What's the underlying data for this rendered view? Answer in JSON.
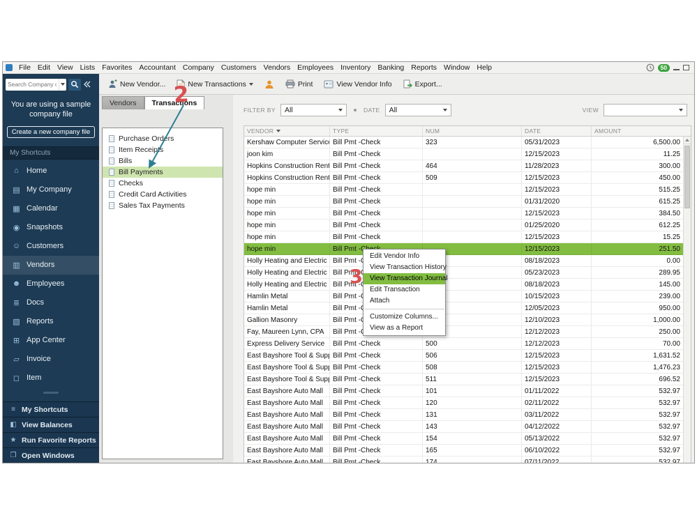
{
  "app": {
    "menu": [
      "File",
      "Edit",
      "View",
      "Lists",
      "Favorites",
      "Accountant",
      "Company",
      "Customers",
      "Vendors",
      "Employees",
      "Inventory",
      "Banking",
      "Reports",
      "Window",
      "Help"
    ],
    "badge_count": "50"
  },
  "toolbar": {
    "search": {
      "placeholder": "Search Company or Help"
    },
    "new_vendor": "New Vendor...",
    "new_transactions": "New Transactions",
    "print": "Print",
    "view_vendor_info": "View Vendor Info",
    "export": "Export..."
  },
  "sidebar": {
    "notice": "You are using a sample company file",
    "create_button": "Create a new company file",
    "shortcuts_header": "My Shortcuts",
    "items": [
      {
        "label": "Home",
        "icon": "home-icon",
        "glyph": "⌂",
        "active": false
      },
      {
        "label": "My Company",
        "icon": "my-company-icon",
        "glyph": "▤",
        "active": false
      },
      {
        "label": "Calendar",
        "icon": "calendar-icon",
        "glyph": "▦",
        "active": false
      },
      {
        "label": "Snapshots",
        "icon": "snapshots-icon",
        "glyph": "◉",
        "active": false
      },
      {
        "label": "Customers",
        "icon": "customers-icon",
        "glyph": "☺",
        "active": false
      },
      {
        "label": "Vendors",
        "icon": "vendors-icon",
        "glyph": "▥",
        "active": true
      },
      {
        "label": "Employees",
        "icon": "employees-icon",
        "glyph": "☻",
        "active": false
      },
      {
        "label": "Docs",
        "icon": "docs-icon",
        "glyph": "≣",
        "active": false
      },
      {
        "label": "Reports",
        "icon": "reports-icon",
        "glyph": "▧",
        "active": false
      },
      {
        "label": "App Center",
        "icon": "app-center-icon",
        "glyph": "⊞",
        "active": false
      },
      {
        "label": "Invoice",
        "icon": "invoice-icon",
        "glyph": "▱",
        "active": false
      },
      {
        "label": "Item",
        "icon": "item-icon",
        "glyph": "◻",
        "active": false
      }
    ],
    "bottom_sections": [
      {
        "label": "My Shortcuts",
        "icon": "my-shortcuts-icon",
        "glyph": "≡"
      },
      {
        "label": "View Balances",
        "icon": "view-balances-icon",
        "glyph": "◧"
      },
      {
        "label": "Run Favorite Reports",
        "icon": "run-favorite-reports-icon",
        "glyph": "★"
      },
      {
        "label": "Open Windows",
        "icon": "open-windows-icon",
        "glyph": "❐"
      }
    ]
  },
  "center": {
    "tabs": [
      {
        "label": "Vendors"
      },
      {
        "label": "Transactions"
      }
    ],
    "items": [
      "Purchase Orders",
      "Item Receipts",
      "Bills",
      "Bill Payments",
      "Checks",
      "Credit Card Activities",
      "Sales Tax Payments"
    ],
    "selected": "Bill Payments"
  },
  "filters": {
    "filter_by_label": "FILTER BY",
    "filter_by_value": "All",
    "date_label": "DATE",
    "date_value": "All",
    "view_label": "VIEW",
    "view_value": ""
  },
  "table": {
    "columns": [
      "VENDOR",
      "TYPE",
      "NUM",
      "DATE",
      "AMOUNT"
    ],
    "selected_index": 9,
    "rows": [
      {
        "vendor": "Kershaw Computer Services",
        "type": "Bill Pmt -Check",
        "num": "323",
        "date": "05/31/2023",
        "amount": "6,500.00"
      },
      {
        "vendor": "joon kim",
        "type": "Bill Pmt -Check",
        "num": "",
        "date": "12/15/2023",
        "amount": "11.25"
      },
      {
        "vendor": "Hopkins Construction Rentals",
        "type": "Bill Pmt -Check",
        "num": "464",
        "date": "11/28/2023",
        "amount": "300.00"
      },
      {
        "vendor": "Hopkins Construction Rentals",
        "type": "Bill Pmt -Check",
        "num": "509",
        "date": "12/15/2023",
        "amount": "450.00"
      },
      {
        "vendor": "hope min",
        "type": "Bill Pmt -Check",
        "num": "",
        "date": "12/15/2023",
        "amount": "515.25"
      },
      {
        "vendor": "hope min",
        "type": "Bill Pmt -Check",
        "num": "",
        "date": "01/31/2020",
        "amount": "615.25"
      },
      {
        "vendor": "hope min",
        "type": "Bill Pmt -Check",
        "num": "",
        "date": "12/15/2023",
        "amount": "384.50"
      },
      {
        "vendor": "hope min",
        "type": "Bill Pmt -Check",
        "num": "",
        "date": "01/25/2020",
        "amount": "612.25"
      },
      {
        "vendor": "hope min",
        "type": "Bill Pmt -Check",
        "num": "",
        "date": "12/15/2023",
        "amount": "15.25"
      },
      {
        "vendor": "hope min",
        "type": "Bill Pmt -Check",
        "num": "",
        "date": "12/15/2023",
        "amount": "251.50"
      },
      {
        "vendor": "Holly Heating and Electric",
        "type": "Bill Pmt -Check",
        "num": "",
        "date": "08/18/2023",
        "amount": "0.00"
      },
      {
        "vendor": "Holly Heating and Electric",
        "type": "Bill Pmt -Check",
        "num": "",
        "date": "05/23/2023",
        "amount": "289.95"
      },
      {
        "vendor": "Holly Heating and Electric",
        "type": "Bill Pmt -Check",
        "num": "",
        "date": "08/18/2023",
        "amount": "145.00"
      },
      {
        "vendor": "Hamlin Metal",
        "type": "Bill Pmt -Check",
        "num": "",
        "date": "10/15/2023",
        "amount": "239.00"
      },
      {
        "vendor": "Hamlin Metal",
        "type": "Bill Pmt -Check",
        "num": "",
        "date": "12/05/2023",
        "amount": "950.00"
      },
      {
        "vendor": "Gallion Masonry",
        "type": "Bill Pmt -Check",
        "num": "",
        "date": "12/10/2023",
        "amount": "1,000.00"
      },
      {
        "vendor": "Fay, Maureen Lynn, CPA",
        "type": "Bill Pmt -Check",
        "num": "",
        "date": "12/12/2023",
        "amount": "250.00"
      },
      {
        "vendor": "Express Delivery Service",
        "type": "Bill Pmt -Check",
        "num": "500",
        "date": "12/12/2023",
        "amount": "70.00"
      },
      {
        "vendor": "East Bayshore Tool & Supply",
        "type": "Bill Pmt -Check",
        "num": "506",
        "date": "12/15/2023",
        "amount": "1,631.52"
      },
      {
        "vendor": "East Bayshore Tool & Supply",
        "type": "Bill Pmt -Check",
        "num": "508",
        "date": "12/15/2023",
        "amount": "1,476.23"
      },
      {
        "vendor": "East Bayshore Tool & Supply",
        "type": "Bill Pmt -Check",
        "num": "511",
        "date": "12/15/2023",
        "amount": "696.52"
      },
      {
        "vendor": "East Bayshore Auto Mall",
        "type": "Bill Pmt -Check",
        "num": "101",
        "date": "01/11/2022",
        "amount": "532.97"
      },
      {
        "vendor": "East Bayshore Auto Mall",
        "type": "Bill Pmt -Check",
        "num": "120",
        "date": "02/11/2022",
        "amount": "532.97"
      },
      {
        "vendor": "East Bayshore Auto Mall",
        "type": "Bill Pmt -Check",
        "num": "131",
        "date": "03/11/2022",
        "amount": "532.97"
      },
      {
        "vendor": "East Bayshore Auto Mall",
        "type": "Bill Pmt -Check",
        "num": "143",
        "date": "04/12/2022",
        "amount": "532.97"
      },
      {
        "vendor": "East Bayshore Auto Mall",
        "type": "Bill Pmt -Check",
        "num": "154",
        "date": "05/13/2022",
        "amount": "532.97"
      },
      {
        "vendor": "East Bayshore Auto Mall",
        "type": "Bill Pmt -Check",
        "num": "165",
        "date": "06/10/2022",
        "amount": "532.97"
      },
      {
        "vendor": "East Bayshore Auto Mall",
        "type": "Bill Pmt -Check",
        "num": "174",
        "date": "07/11/2022",
        "amount": "532.97"
      }
    ]
  },
  "context_menu": {
    "groups": [
      [
        "Edit Vendor Info",
        "View Transaction History",
        "View Transaction Journal",
        "Edit Transaction",
        "Attach"
      ],
      [
        "Customize Columns...",
        "View as a Report"
      ]
    ],
    "highlighted": "View Transaction Journal"
  },
  "annotations": {
    "step2": "2",
    "step3": "3"
  },
  "colors": {
    "selection_green": "#82bd41",
    "soft_green": "#cfe5af",
    "sidebar_navy": "#1d3b54",
    "annotation_red": "#d95050",
    "arrow_teal": "#2e7e93"
  }
}
